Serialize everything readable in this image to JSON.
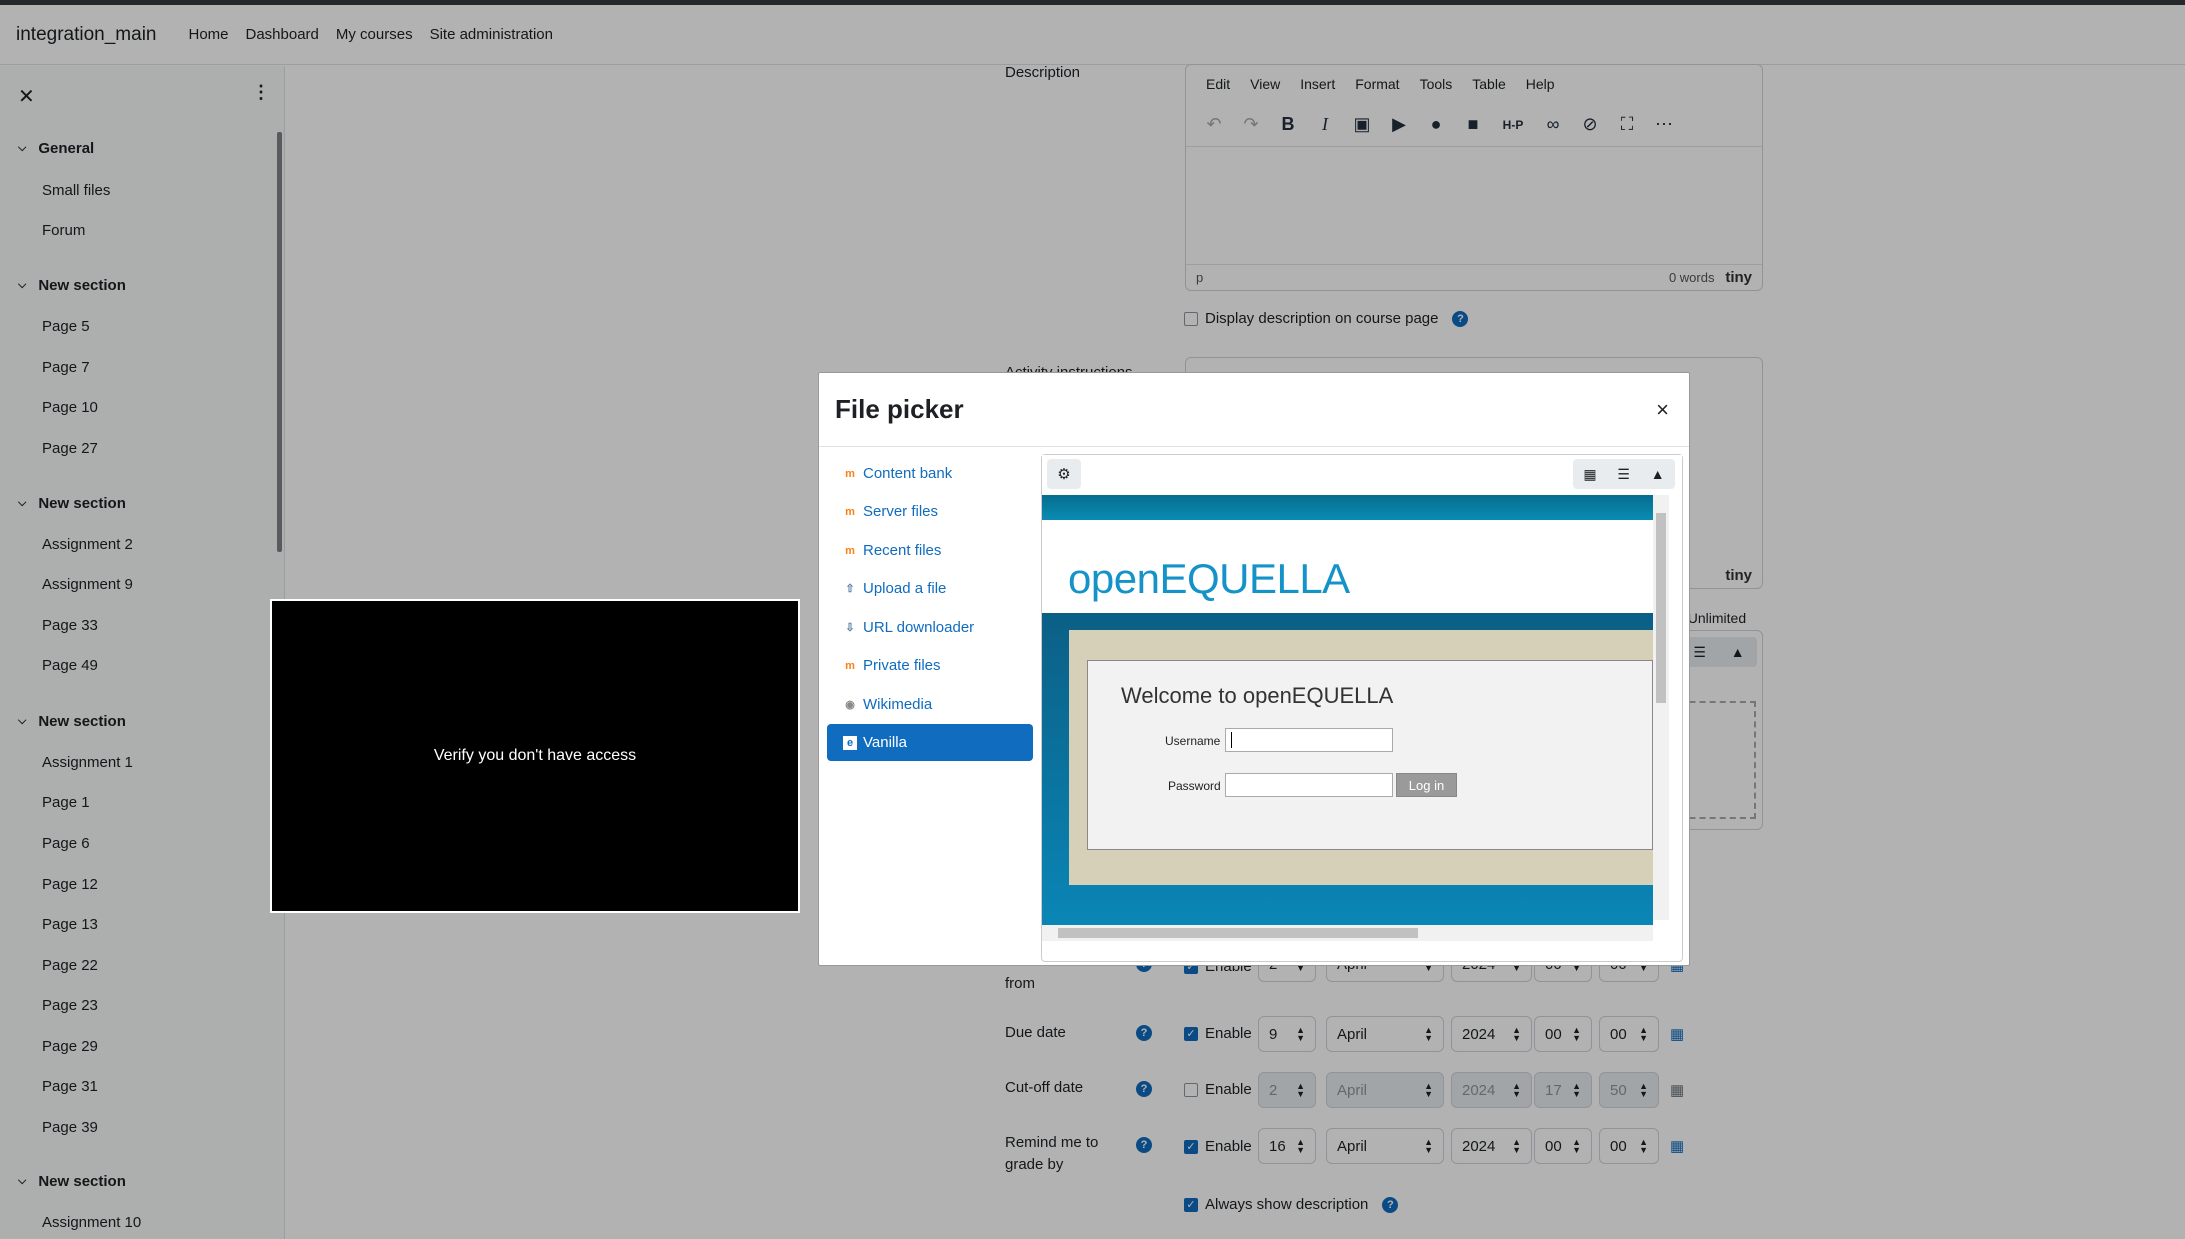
{
  "navbar": {
    "site_name": "integration_main",
    "links": [
      "Home",
      "Dashboard",
      "My courses",
      "Site administration"
    ]
  },
  "drawer": {
    "close_glyph": "✕",
    "menu_glyph": "⋮",
    "sections": [
      {
        "title": "General",
        "items": [
          "Small files",
          "Forum"
        ]
      },
      {
        "title": "New section",
        "items": [
          "Page 5",
          "Page 7",
          "Page 10",
          "Page 27"
        ]
      },
      {
        "title": "New section",
        "items": [
          "Assignment 2",
          "Assignment 9",
          "Page 33",
          "Page 49"
        ]
      },
      {
        "title": "New section",
        "items": [
          "Assignment 1",
          "Page 1",
          "Page 6",
          "Page 12",
          "Page 13",
          "Page 22",
          "Page 23",
          "Page 29",
          "Page 31",
          "Page 39"
        ]
      },
      {
        "title": "New section",
        "items": [
          "Assignment 10"
        ]
      }
    ]
  },
  "form": {
    "description_label": "Description",
    "activity_instructions_label": "Activity instructions",
    "editor_menu": [
      "Edit",
      "View",
      "Insert",
      "Format",
      "Tools",
      "Table",
      "Help"
    ],
    "editor_status_path": "p",
    "editor_word_count": "0 words",
    "editor_brand": "tiny",
    "display_description": "Display description on course page",
    "max_attachments_suffix": ": Unlimited",
    "allow_submissions_label": "Allow submissions from",
    "due_date_label": "Due date",
    "cutoff_date_label": "Cut-off date",
    "remind_label": "Remind me to grade by",
    "enable_label": "Enable",
    "always_show": "Always show description",
    "due": {
      "day": "9",
      "month": "April",
      "year": "2024",
      "hour": "00",
      "minute": "00"
    },
    "cutoff": {
      "day": "2",
      "month": "April",
      "year": "2024",
      "hour": "17",
      "minute": "50"
    },
    "remind": {
      "day": "16",
      "month": "April",
      "year": "2024",
      "hour": "00",
      "minute": "00"
    },
    "allow": {
      "day": "2",
      "month": "April",
      "year": "2024",
      "hour": "00",
      "minute": "00"
    }
  },
  "overlay_box": {
    "text": "Verify you don't have access"
  },
  "file_picker": {
    "title": "File picker",
    "close_glyph": "×",
    "repositories": [
      {
        "label": "Content bank",
        "icon": "moodle-icon"
      },
      {
        "label": "Server files",
        "icon": "moodle-icon"
      },
      {
        "label": "Recent files",
        "icon": "moodle-icon"
      },
      {
        "label": "Upload a file",
        "icon": "upload-icon"
      },
      {
        "label": "URL downloader",
        "icon": "download-icon"
      },
      {
        "label": "Private files",
        "icon": "moodle-icon"
      },
      {
        "label": "Wikimedia",
        "icon": "wikimedia-icon"
      },
      {
        "label": "Vanilla",
        "icon": "equella-icon",
        "active": true
      }
    ],
    "equella": {
      "logo_open": "open",
      "logo_equella": "EQUELLA",
      "welcome": "Welcome to openEQUELLA",
      "username_label": "Username",
      "password_label": "Password",
      "login_button": "Log in"
    }
  }
}
